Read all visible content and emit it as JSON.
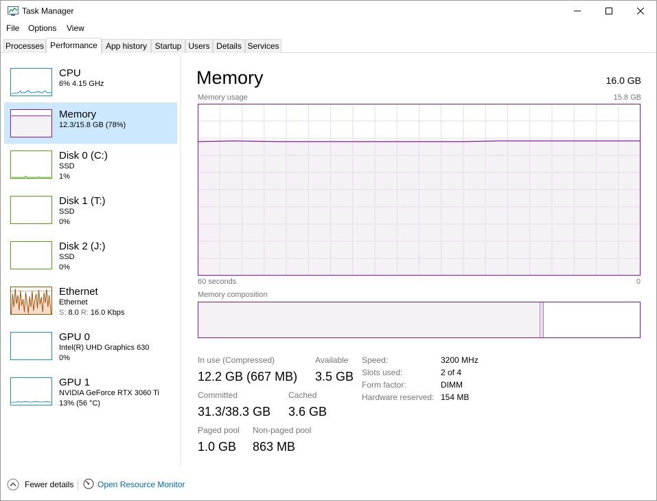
{
  "window": {
    "title": "Task Manager"
  },
  "menu": [
    "File",
    "Options",
    "View"
  ],
  "tabs": [
    "Processes",
    "Performance",
    "App history",
    "Startup",
    "Users",
    "Details",
    "Services"
  ],
  "active_tab": "Performance",
  "sidebar": {
    "items": [
      {
        "title": "CPU",
        "line1": "6%  4.15 GHz",
        "line2": "",
        "color": "#1a8cd8",
        "usage_percent": 6
      },
      {
        "title": "Memory",
        "line1": "12.3/15.8 GB (78%)",
        "line2": "",
        "color": "#8b12ae",
        "usage_percent": 78
      },
      {
        "title": "Disk 0 (C:)",
        "line1": "SSD",
        "line2": "1%",
        "color": "#4da60c",
        "usage_percent": 1
      },
      {
        "title": "Disk 1 (T:)",
        "line1": "SSD",
        "line2": "0%",
        "color": "#4da60c",
        "usage_percent": 0
      },
      {
        "title": "Disk 2 (J:)",
        "line1": "SSD",
        "line2": "0%",
        "color": "#4da60c",
        "usage_percent": 0
      },
      {
        "title": "Ethernet",
        "line1": "Ethernet",
        "line2_prefix_s": "S:",
        "line2_s": "8.0",
        "line2_prefix_r": "R:",
        "line2_r": "16.0 Kbps",
        "color": "#a74f01"
      },
      {
        "title": "GPU 0",
        "line1": "Intel(R) UHD Graphics 630",
        "line2": "0%",
        "color": "#1a8cd8",
        "usage_percent": 0
      },
      {
        "title": "GPU 1",
        "line1": "NVIDIA GeForce RTX 3060 Ti",
        "line2": "13%  (56 °C)",
        "color": "#1a8cd8",
        "usage_percent": 13
      }
    ]
  },
  "main": {
    "title": "Memory",
    "total": "16.0 GB",
    "usage_label": "Memory usage",
    "usage_max": "15.8 GB",
    "axis_left": "60 seconds",
    "axis_right": "0",
    "composition_label": "Memory composition",
    "usage_percent": 78,
    "stats": {
      "in_use_label": "In use (Compressed)",
      "in_use_value": "12.2 GB (667 MB)",
      "available_label": "Available",
      "available_value": "3.5 GB",
      "committed_label": "Committed",
      "committed_value": "31.3/38.3 GB",
      "cached_label": "Cached",
      "cached_value": "3.6 GB",
      "paged_label": "Paged pool",
      "paged_value": "1.0 GB",
      "nonpaged_label": "Non-paged pool",
      "nonpaged_value": "863 MB"
    },
    "details": [
      {
        "label": "Speed:",
        "value": "3200 MHz"
      },
      {
        "label": "Slots used:",
        "value": "2 of 4"
      },
      {
        "label": "Form factor:",
        "value": "DIMM"
      },
      {
        "label": "Hardware reserved:",
        "value": "154 MB"
      }
    ]
  },
  "footer": {
    "fewer_details": "Fewer details",
    "open_resource_monitor": "Open Resource Monitor"
  },
  "colors": {
    "memory": "#8b12ae",
    "cpu": "#1a8cd8",
    "disk": "#4da60c",
    "ethernet": "#a74f01",
    "selected_bg": "#cce8ff",
    "link": "#0066cc"
  }
}
